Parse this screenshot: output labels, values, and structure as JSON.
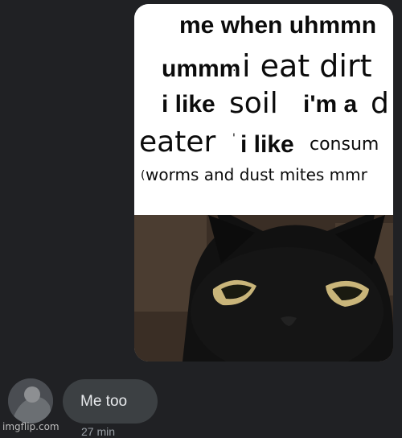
{
  "conversation": {
    "image_message": {
      "meme_caption": {
        "line1": "me when uhmmn",
        "line2_bold": "ummm",
        "line2_sep": ":",
        "line2_thin": "i eat dirt",
        "line3_bold_a": "i like",
        "line3_thin_a": "soil",
        "line3_bold_b": "i'm a",
        "line3_thin_b": "d",
        "line4_thin": "eater",
        "line4_sep": "'",
        "line4_bold": "i like",
        "line4_thin_b": "consum",
        "line5_sep": "(",
        "line5_thin": "worms and dust mites mmr"
      }
    },
    "text_message": {
      "text": "Me too",
      "timestamp": "27 min"
    }
  },
  "watermark": "imgflip.com",
  "colors": {
    "background": "#202124",
    "bubble": "#3c4043",
    "text": "#e8eaed",
    "timestamp": "#9aa0a6"
  },
  "icons": [
    "cat-face-image",
    "avatar-image"
  ]
}
